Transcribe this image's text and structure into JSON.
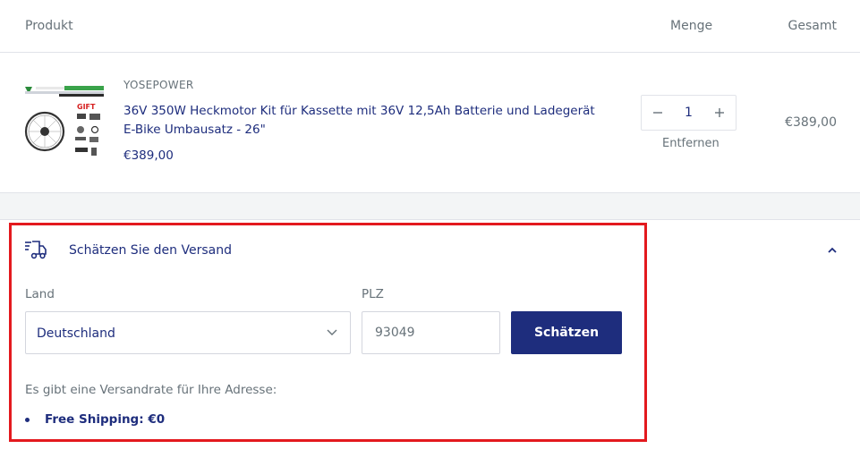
{
  "cart_table": {
    "headers": {
      "product": "Produkt",
      "quantity": "Menge",
      "total": "Gesamt"
    }
  },
  "line_item": {
    "vendor": "YOSEPOWER",
    "title": "36V 350W Heckmotor Kit für Kassette mit 36V 12,5Ah Batterie und Ladegerät E-Bike Umbausatz - 26\"",
    "price": "€389,00",
    "quantity": "1",
    "remove_label": "Entfernen",
    "line_total": "€389,00",
    "thumbnail_text": {
      "gift": "GIFT"
    }
  },
  "shipping_estimator": {
    "title": "Schätzen Sie den Versand",
    "country_label": "Land",
    "country_value": "Deutschland",
    "zip_label": "PLZ",
    "zip_value": "93049",
    "submit_label": "Schätzen",
    "result_message": "Es gibt eine Versandrate für Ihre Adresse:",
    "rates": [
      "Free Shipping: €0"
    ]
  },
  "icons": {
    "truck": "shipping-truck-icon",
    "collapse": "chevron-up-icon",
    "select": "chevron-down-icon",
    "minus": "minus-icon",
    "plus": "plus-icon"
  },
  "colors": {
    "brand_navy": "#1e2d7d",
    "muted_text": "#677279",
    "border": "#e1e3e9",
    "band": "#f3f5f6",
    "highlight": "#e3191e"
  }
}
